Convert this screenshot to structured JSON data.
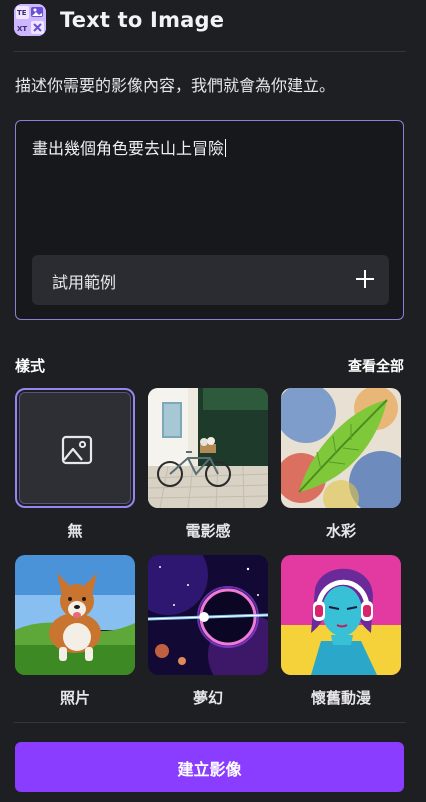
{
  "header": {
    "title": "Text to Image",
    "icon": "text-to-image-app-icon"
  },
  "instruction": "描述你需要的影像內容，我們就會為你建立。",
  "prompt": {
    "value": "畫出幾個角色要去山上冒險"
  },
  "examples_button": {
    "label": "試用範例",
    "icon": "plus-icon"
  },
  "styles": {
    "heading": "樣式",
    "view_all": "查看全部",
    "items": [
      {
        "label": "無",
        "selected": true,
        "icon": "image-placeholder-icon"
      },
      {
        "label": "電影感",
        "selected": false,
        "thumbnail": "bicycle-street-photo"
      },
      {
        "label": "水彩",
        "selected": false,
        "thumbnail": "watercolor-leaf"
      },
      {
        "label": "照片",
        "selected": false,
        "thumbnail": "corgi-running-photo"
      },
      {
        "label": "夢幻",
        "selected": false,
        "thumbnail": "cosmic-planet"
      },
      {
        "label": "懷舊動漫",
        "selected": false,
        "thumbnail": "retro-anime-headphones-girl"
      }
    ]
  },
  "create_button": {
    "label": "建立影像"
  },
  "colors": {
    "background": "#1e1f23",
    "accent": "#8b3dff",
    "selection_border": "#9a82f0",
    "prompt_border": "#8b80d6"
  }
}
